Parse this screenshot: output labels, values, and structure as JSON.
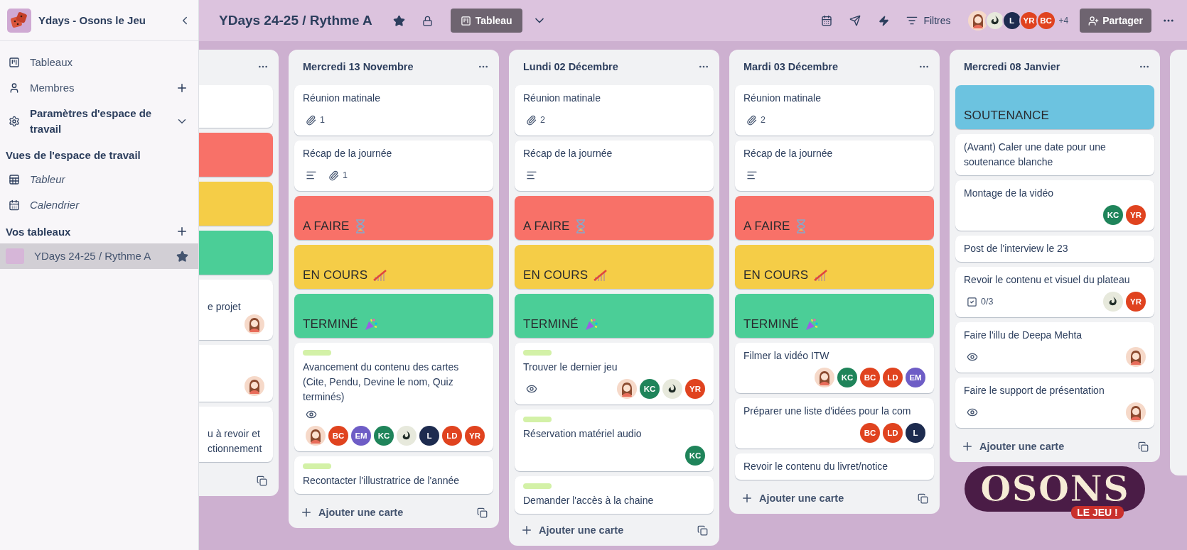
{
  "workspace": {
    "name": "Ydays - Osons le Jeu"
  },
  "sidebar": {
    "items": [
      {
        "label": "Tableaux",
        "kind": "boards"
      },
      {
        "label": "Membres",
        "kind": "members"
      },
      {
        "label": "Paramètres d'espace de travail",
        "kind": "settings"
      }
    ],
    "views_heading": "Vues de l'espace de travail",
    "views": [
      {
        "label": "Tableur",
        "kind": "table"
      },
      {
        "label": "Calendrier",
        "kind": "calendar"
      }
    ],
    "boards_heading": "Vos tableaux",
    "boards": [
      {
        "label": "YDays 24-25 / Rythme A",
        "selected": true,
        "starred": true
      }
    ]
  },
  "header": {
    "title": "YDays 24-25 / Rythme A",
    "starred": true,
    "view_button": "Tableau",
    "filter": "Filtres",
    "members": [
      {
        "kind": "picture"
      },
      {
        "kind": "emblem"
      },
      {
        "kind": "initials",
        "initials": "L",
        "color": "#1d2b4f"
      },
      {
        "kind": "initials",
        "initials": "YR",
        "color": "#e0431f"
      },
      {
        "kind": "initials",
        "initials": "BC",
        "color": "#e0431f"
      }
    ],
    "more_members": "+4",
    "share": "Partager"
  },
  "list_fragment": {
    "cards": [
      {
        "kind": "task"
      },
      {
        "kind": "todo",
        "color": "#f87168"
      },
      {
        "kind": "doing",
        "color": "#f5cd47"
      },
      {
        "kind": "done",
        "color": "#4bce97"
      },
      {
        "kind": "task",
        "lines": [
          "e projet"
        ],
        "members": [
          {
            "kind": "picture"
          }
        ]
      },
      {
        "kind": "task",
        "members": [
          {
            "kind": "picture"
          }
        ]
      },
      {
        "kind": "task",
        "lines": [
          "u à revoir et",
          "ctionnement"
        ]
      }
    ]
  },
  "lists": [
    {
      "title": "Mercredi 13 Novembre",
      "add": "Ajouter une carte",
      "cards": [
        {
          "kind": "task",
          "title": "Réunion matinale",
          "attachments": "1"
        },
        {
          "kind": "task",
          "title": "Récap de la journée",
          "description": true,
          "attachments": "1"
        },
        {
          "kind": "todo",
          "title": "A FAIRE",
          "color": "#f87168"
        },
        {
          "kind": "doing",
          "title": "EN COURS",
          "color": "#f5cd47"
        },
        {
          "kind": "done",
          "title": "TERMINÉ",
          "color": "#4bce97"
        },
        {
          "kind": "task",
          "label": {
            "color": "#d3f1a7"
          },
          "title": "Avancement du contenu des cartes (Cite, Pendu, Devine le nom, Quiz terminés)",
          "watching": true,
          "members": [
            {
              "kind": "picture"
            },
            {
              "kind": "initials",
              "initials": "BC",
              "color": "#e0431f"
            },
            {
              "kind": "initials",
              "initials": "EM",
              "color": "#6e5dc6"
            },
            {
              "kind": "initials",
              "initials": "KC",
              "color": "#1f845a"
            },
            {
              "kind": "emblem"
            },
            {
              "kind": "initials",
              "initials": "L",
              "color": "#1d2b4f"
            },
            {
              "kind": "initials",
              "initials": "LD",
              "color": "#e0431f"
            },
            {
              "kind": "initials",
              "initials": "YR",
              "color": "#e0431f"
            }
          ]
        },
        {
          "kind": "task",
          "label": {
            "color": "#d3f1a7"
          },
          "title": "Recontacter l'illustratrice de l'année"
        }
      ]
    },
    {
      "title": "Lundi 02 Décembre",
      "add": "Ajouter une carte",
      "cards": [
        {
          "kind": "task",
          "title": "Réunion matinale",
          "attachments": "2"
        },
        {
          "kind": "task",
          "title": "Récap de la journée",
          "description": true
        },
        {
          "kind": "todo",
          "title": "A FAIRE",
          "color": "#f87168"
        },
        {
          "kind": "doing",
          "title": "EN COURS",
          "color": "#f5cd47"
        },
        {
          "kind": "done",
          "title": "TERMINÉ",
          "color": "#4bce97"
        },
        {
          "kind": "task",
          "label": {
            "color": "#d3f1a7"
          },
          "title": "Trouver le dernier jeu",
          "watching": true,
          "members": [
            {
              "kind": "picture"
            },
            {
              "kind": "initials",
              "initials": "KC",
              "color": "#1f845a"
            },
            {
              "kind": "emblem"
            },
            {
              "kind": "initials",
              "initials": "YR",
              "color": "#e0431f"
            }
          ]
        },
        {
          "kind": "task",
          "label": {
            "color": "#d3f1a7"
          },
          "title": "Réservation matériel audio",
          "members": [
            {
              "kind": "initials",
              "initials": "KC",
              "color": "#1f845a"
            }
          ]
        },
        {
          "kind": "task",
          "label": {
            "color": "#d3f1a7"
          },
          "title": "Demander l'accès à la chaine"
        }
      ]
    },
    {
      "title": "Mardi 03 Décembre",
      "add": "Ajouter une carte",
      "cards": [
        {
          "kind": "task",
          "title": "Réunion matinale",
          "attachments": "2"
        },
        {
          "kind": "task",
          "title": "Récap de la journée",
          "description": true
        },
        {
          "kind": "todo",
          "title": "A FAIRE",
          "color": "#f87168"
        },
        {
          "kind": "doing",
          "title": "EN COURS",
          "color": "#f5cd47"
        },
        {
          "kind": "done",
          "title": "TERMINÉ",
          "color": "#4bce97"
        },
        {
          "kind": "task",
          "title": "Filmer la vidéo ITW",
          "members": [
            {
              "kind": "picture"
            },
            {
              "kind": "initials",
              "initials": "KC",
              "color": "#1f845a"
            },
            {
              "kind": "initials",
              "initials": "BC",
              "color": "#e0431f"
            },
            {
              "kind": "initials",
              "initials": "LD",
              "color": "#e0431f"
            },
            {
              "kind": "initials",
              "initials": "EM",
              "color": "#6e5dc6"
            }
          ]
        },
        {
          "kind": "task",
          "title": "Préparer une liste d'idées pour la com",
          "members": [
            {
              "kind": "initials",
              "initials": "BC",
              "color": "#e0431f"
            },
            {
              "kind": "initials",
              "initials": "LD",
              "color": "#e0431f"
            },
            {
              "kind": "initials",
              "initials": "L",
              "color": "#1d2b4f"
            }
          ]
        },
        {
          "kind": "task",
          "title": "Revoir le contenu du livret/notice"
        }
      ]
    },
    {
      "title": "Mercredi 08 Janvier",
      "add": "Ajouter une carte",
      "cards": [
        {
          "kind": "milestone",
          "title": "SOUTENANCE",
          "color": "#6cc3e0"
        },
        {
          "kind": "task",
          "title": "(Avant) Caler une date pour une soutenance blanche"
        },
        {
          "kind": "task",
          "title": "Montage de la vidéo",
          "members": [
            {
              "kind": "initials",
              "initials": "KC",
              "color": "#1f845a"
            },
            {
              "kind": "initials",
              "initials": "YR",
              "color": "#e0431f"
            }
          ]
        },
        {
          "kind": "task",
          "title": "Post de l'interview le 23"
        },
        {
          "kind": "task",
          "title": "Revoir le contenu et visuel du plateau",
          "checklist": "0/3",
          "members": [
            {
              "kind": "emblem"
            },
            {
              "kind": "initials",
              "initials": "YR",
              "color": "#e0431f"
            }
          ]
        },
        {
          "kind": "task",
          "title": "Faire l'illu de Deepa Mehta",
          "watching": true,
          "members": [
            {
              "kind": "picture"
            }
          ]
        },
        {
          "kind": "task",
          "title": "Faire le support de présentation",
          "watching": true,
          "members": [
            {
              "kind": "picture"
            }
          ]
        }
      ]
    }
  ],
  "background_logo": {
    "word": "OSONS",
    "tagline": "LE JEU !"
  }
}
